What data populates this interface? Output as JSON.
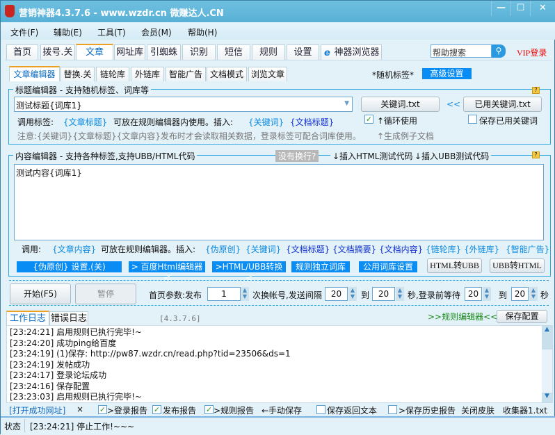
{
  "window": {
    "title": "营销神器4.3.7.6 - www.wzdr.cn 微赚达人.CN",
    "minimize": "—",
    "maximize": "☐",
    "close": "✕"
  },
  "menu": [
    "文件(F)",
    "辅助(E)",
    "工具(T)",
    "会员(M)",
    "帮助(H)"
  ],
  "tabs": [
    "首页",
    "拨号.关",
    "文章",
    "网址库",
    "引蜘蛛",
    "识别",
    "短信",
    "规则",
    "设置",
    "神器浏览器"
  ],
  "search": {
    "placeholder": "帮助搜索"
  },
  "vip_login": "VIP登录",
  "subtabs": [
    "文章编辑器",
    "替换.关",
    "链轮库",
    "外链库",
    "智能广告",
    "文档模式",
    "浏览文章"
  ],
  "random_tag": "*随机标签*",
  "advanced": "高级设置",
  "title_editor": {
    "label": "标题编辑器 - 支持随机标签、词库等",
    "value": "测试标题{词库1}",
    "keyword_btn": "关键词.txt",
    "arrows": "<<",
    "used_keyword_btn": "已用关键词.txt",
    "call_label": "调用标签:",
    "call_tag": "{文章标题}",
    "call_desc": "可放在规则编辑器内使用。插入:",
    "insert_keyword": "{关键词}",
    "insert_doc_title": "{文档标题}",
    "loop_use": "↑循环使用",
    "save_used": "保存已用关键词",
    "note": "注意:{关键词}{文章标题}{文章内容}发布时才会读取相关数据，登录标签可配合词库使用。",
    "gen_example": "↑生成例子文档"
  },
  "content_editor": {
    "label": "内容编辑器 - 支持各种标签,支持UBB/HTML代码",
    "no_newline": "没有换行?",
    "insert_html": "↓插入HTML测试代码",
    "insert_ubb": "↓插入UBB测试代码",
    "value": "测试内容{词库1}",
    "call_label": "调用:",
    "call_tag": "{文章内容}",
    "call_desc": "可放在规则编辑器。插入:",
    "inserts": [
      "{伪原创}",
      "{关键词}",
      "{文档标题}",
      "{文档摘要}",
      "{文档内容}",
      "{链轮库}",
      "{外链库}",
      "{智能广告}"
    ],
    "buttons": [
      "{伪原创} 设置.(关)",
      "> 百度Html编辑器<",
      ">HTML/UBB转换<",
      "规则独立词库",
      "公用词库设置"
    ],
    "html_to_ubb": "HTML转UBB",
    "ubb_to_html": "UBB转HTML"
  },
  "controls": {
    "start": "开始(F5)",
    "pause": "暂停",
    "p1": "首页参数:发布",
    "v1": "1",
    "p2": "次换帐号,发送间隔",
    "v2": "20",
    "to1": "到",
    "v3": "20",
    "p3": "秒,登录前等待",
    "v4": "20",
    "to2": "到",
    "v5": "20",
    "sec": "秒"
  },
  "log": {
    "tabs": [
      "工作日志",
      "错误日志"
    ],
    "version": "[4.3.7.6]",
    "rule_editor": ">>规则编辑器<<",
    "save_config": "保存配置",
    "lines": [
      "[23:24:21] 启用规则已执行完毕!~",
      "[23:24:20] 成功ping给百度",
      "[23:24:19] (1)保存: http://pw87.wzdr.cn/read.php?tid=23506&ds=1",
      "[23:24:19] 发帖成功",
      "[23:24:17] 登录论坛成功",
      "[23:24:16] 保存配置",
      "[23:23:03] 启用规则已执行完毕!~"
    ]
  },
  "bottom": {
    "open_url": "[打开成功网址]",
    "x": "×",
    "login_report": ">登录报告",
    "publish_report": "发布报告",
    "rule_report": ">规则报告",
    "manual_save": "←手动保存",
    "save_return": "保存返回文本",
    "save_history": ">保存历史报告",
    "close_skin": "关闭皮肤",
    "collector": "收集器1.txt"
  },
  "status": {
    "label": "状态",
    "text": "[23:24:21] 停止工作!~~~"
  }
}
